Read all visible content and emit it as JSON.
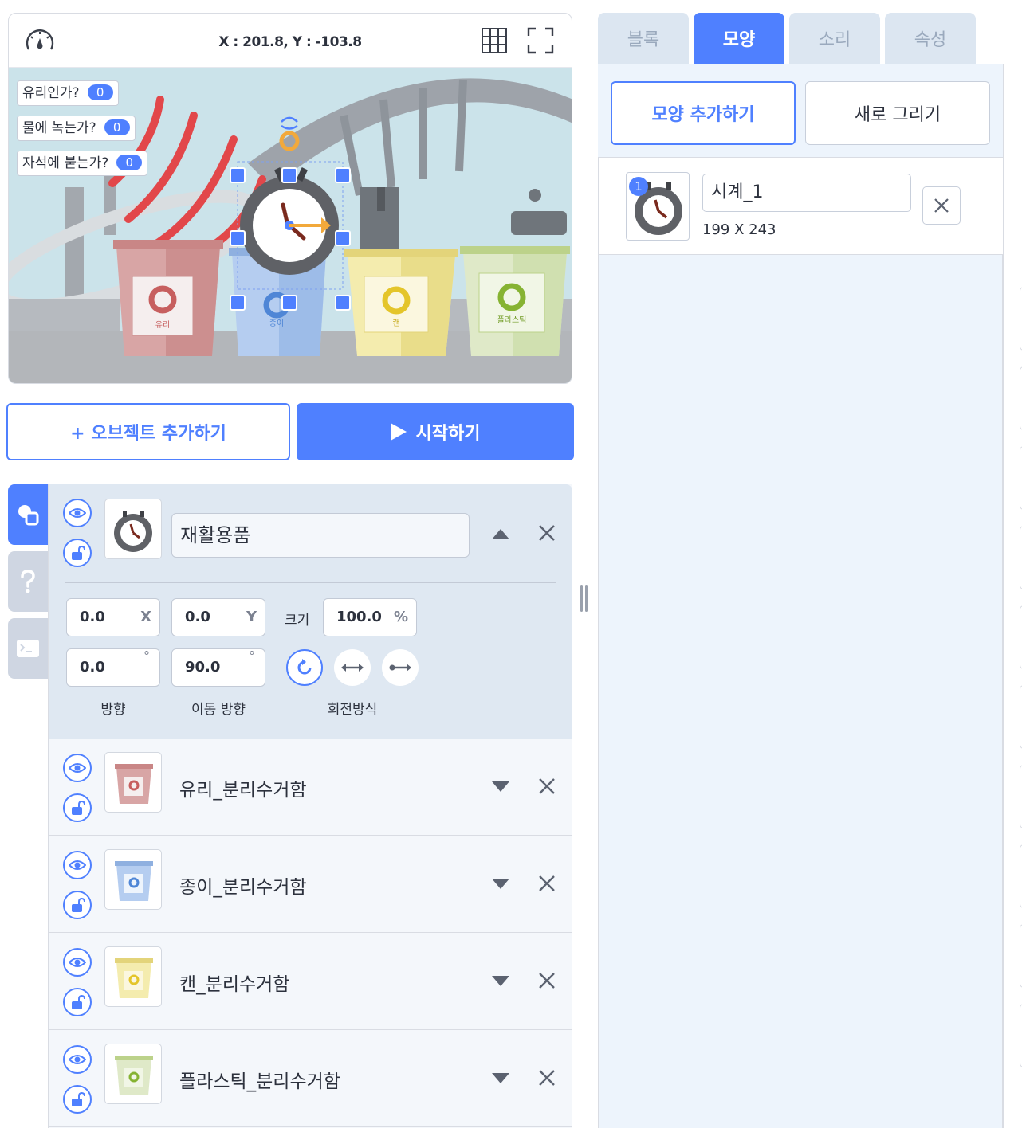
{
  "stage": {
    "coord_text": "X : 201.8, Y : -103.8",
    "variables": [
      {
        "label": "유리인가?",
        "value": "0"
      },
      {
        "label": "물에 녹는가?",
        "value": "0"
      },
      {
        "label": "자석에 붙는가?",
        "value": "0"
      }
    ],
    "bins": [
      {
        "label": "유리",
        "color": "#d98b8b"
      },
      {
        "label": "종이",
        "color": "#8fb3e8"
      },
      {
        "label": "캔",
        "color": "#efe08a"
      },
      {
        "label": "플라스틱",
        "color": "#c8dca0"
      }
    ],
    "icons": {
      "speed": "speedometer-icon",
      "grid": "grid-icon",
      "fullscreen": "fullscreen-icon"
    }
  },
  "buttons": {
    "add_object": "+ 오브젝트 추가하기",
    "start": "시작하기"
  },
  "side_tabs": [
    "object-tab",
    "help-tab",
    "console-tab"
  ],
  "selected_object": {
    "name": "재활용품",
    "x": "0.0",
    "x_unit": "X",
    "y": "0.0",
    "y_unit": "Y",
    "size_label": "크기",
    "size": "100.0",
    "size_unit": "%",
    "direction": "0.0",
    "move_direction": "90.0",
    "degree_symbol": "°",
    "direction_label": "방향",
    "move_direction_label": "이동 방향",
    "rotation_label": "회전방식"
  },
  "objects": [
    {
      "name": "유리_분리수거함",
      "color": "#d98b8b"
    },
    {
      "name": "종이_분리수거함",
      "color": "#8fb3e8"
    },
    {
      "name": "캔_분리수거함",
      "color": "#efe08a"
    },
    {
      "name": "플라스틱_분리수거함",
      "color": "#c8dca0"
    }
  ],
  "tabs": [
    {
      "label": "블록",
      "active": false
    },
    {
      "label": "모양",
      "active": true
    },
    {
      "label": "소리",
      "active": false
    },
    {
      "label": "속성",
      "active": false
    }
  ],
  "shape_panel": {
    "add_shape": "모양 추가하기",
    "new_draw": "새로 그리기",
    "item": {
      "index": "1",
      "name": "시계_1",
      "size": "199 X 243"
    }
  },
  "colors": {
    "accent": "#4f80ff",
    "panel_bg": "#edf4fc",
    "selected_bg": "#dfe8f2"
  }
}
